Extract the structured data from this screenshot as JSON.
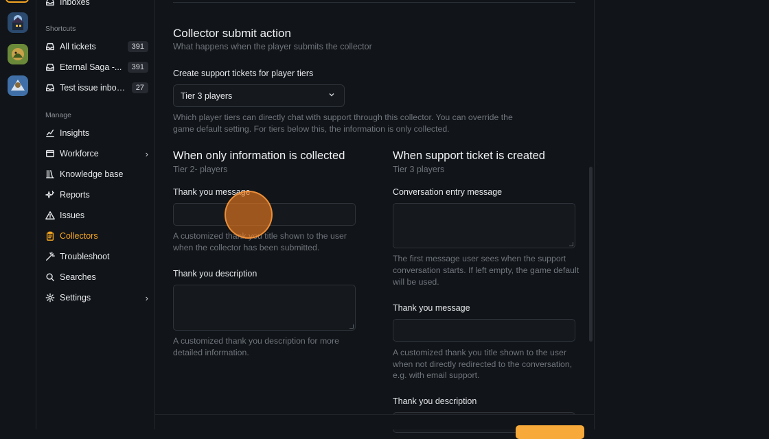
{
  "sidebar": {
    "inboxes_label": "Inboxes",
    "shortcuts_label": "Shortcuts",
    "shortcuts": [
      {
        "label": "All tickets",
        "count": "391"
      },
      {
        "label": "Eternal Saga -...",
        "count": "391"
      },
      {
        "label": "Test issue inbox...",
        "count": "27"
      }
    ],
    "manage_label": "Manage",
    "manage": [
      {
        "label": "Insights",
        "icon": "chart-icon"
      },
      {
        "label": "Workforce",
        "icon": "window-icon"
      },
      {
        "label": "Knowledge base",
        "icon": "books-icon"
      },
      {
        "label": "Reports",
        "icon": "sparkle-icon"
      },
      {
        "label": "Issues",
        "icon": "warning-icon"
      },
      {
        "label": "Collectors",
        "icon": "clipboard-icon"
      },
      {
        "label": "Troubleshoot",
        "icon": "wand-icon"
      },
      {
        "label": "Searches",
        "icon": "search-icon"
      },
      {
        "label": "Settings",
        "icon": "gear-icon"
      }
    ]
  },
  "main": {
    "title": "Collector submit action",
    "subtitle": "What happens when the player submits the collector",
    "tiers_label": "Create support tickets for player tiers",
    "tiers_value": "Tier 3 players",
    "tiers_help_1": "Which player tiers can directly chat with support through this collector. You can override the",
    "tiers_help_2": "game default setting. For tiers below this, the information is only collected.",
    "left": {
      "title": "When only information is collected",
      "subtitle": "Tier 2- players",
      "msg_label": "Thank you message",
      "msg_help_1": "A customized thank you title shown to the user",
      "msg_help_2": "when the collector has been submitted.",
      "desc_label": "Thank you description",
      "desc_help_1": "A customized thank you description for more",
      "desc_help_2": "detailed information."
    },
    "right": {
      "title": "When support ticket is created",
      "subtitle": "Tier 3 players",
      "entry_label": "Conversation entry message",
      "entry_help_1": "The first message user sees when the support",
      "entry_help_2": "conversation starts. If left empty, the game default",
      "entry_help_3": "will be used.",
      "msg_label": "Thank you message",
      "msg_help_1": "A customized thank you title shown to the user",
      "msg_help_2": "when not directly redirected to the conversation,",
      "msg_help_3": "e.g. with email support.",
      "desc_label": "Thank you description"
    }
  },
  "colors": {
    "accent": "#f5a623",
    "background": "#111418"
  }
}
